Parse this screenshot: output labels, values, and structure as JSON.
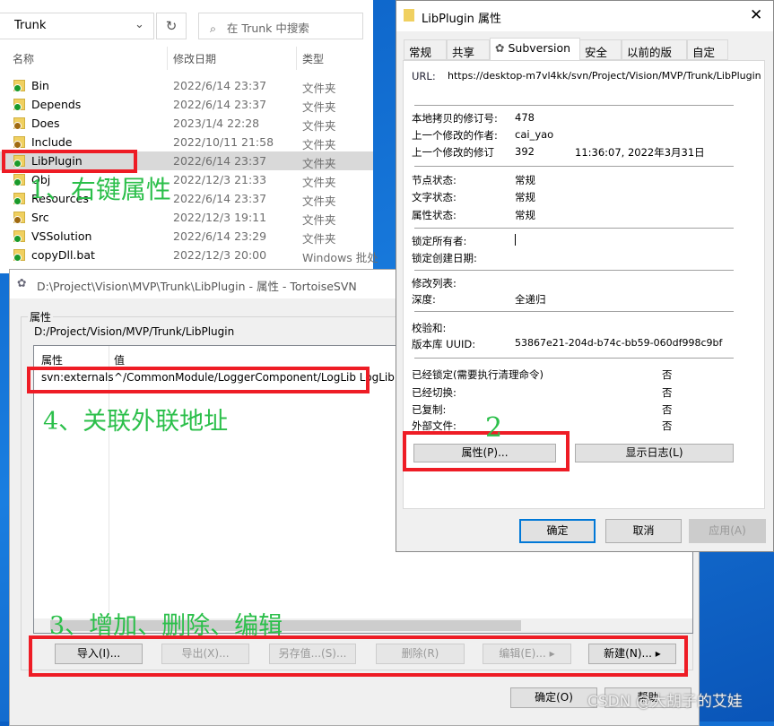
{
  "explorer": {
    "address": "Trunk",
    "search_placeholder": "在 Trunk 中搜索",
    "columns": [
      "名称",
      "修改日期",
      "类型"
    ],
    "rows": [
      {
        "name": "Bin",
        "date": "2022/6/14 23:37",
        "type": "文件夹",
        "status": "ok"
      },
      {
        "name": "Depends",
        "date": "2022/6/14 23:37",
        "type": "文件夹",
        "status": "ok"
      },
      {
        "name": "Does",
        "date": "2023/1/4 22:28",
        "type": "文件夹",
        "status": "modified"
      },
      {
        "name": "Include",
        "date": "2022/10/11 21:58",
        "type": "文件夹",
        "status": "modified"
      },
      {
        "name": "LibPlugin",
        "date": "2022/6/14 23:37",
        "type": "文件夹",
        "status": "ok"
      },
      {
        "name": "Obj",
        "date": "2022/12/3 21:33",
        "type": "文件夹",
        "status": "ok"
      },
      {
        "name": "Resources",
        "date": "2022/6/14 23:37",
        "type": "文件夹",
        "status": "ok"
      },
      {
        "name": "Src",
        "date": "2022/12/3 19:11",
        "type": "文件夹",
        "status": "modified"
      },
      {
        "name": "VSSolution",
        "date": "2022/6/14 23:29",
        "type": "文件夹",
        "status": "ok"
      },
      {
        "name": "copyDll.bat",
        "date": "2022/12/3 20:00",
        "type": "Windows 批处",
        "status": "ok"
      }
    ]
  },
  "annotations": {
    "step1": "1、右键属性",
    "step2": "2",
    "step3": "3、增加、删除、编辑",
    "step4": "4、关联外联地址",
    "watermark": "CSDN @大胡子的艾娃"
  },
  "svn_dialog": {
    "title": "D:\\Project\\Vision\\MVP\\Trunk\\LibPlugin - 属性 - TortoiseSVN",
    "group": "属性",
    "path": "D:/Project/Vision/MVP/Trunk/LibPlugin",
    "headers": [
      "属性",
      "值"
    ],
    "row": {
      "name": "svn:externals",
      "value": "^/CommonModule/LoggerComponent/LogLib LogLib"
    },
    "buttons": {
      "import": "导入(I)...",
      "export": "导出(X)...",
      "save": "另存值...(S)...",
      "delete": "删除(R)",
      "edit": "编辑(E)...",
      "new": "新建(N)...",
      "ok": "确定(O)",
      "help": "帮助"
    }
  },
  "props_dialog": {
    "title": "LibPlugin 属性",
    "tabs": [
      "常规",
      "共享",
      "Subversion",
      "安全",
      "以前的版本",
      "自定义"
    ],
    "url_label": "URL:",
    "url": "https://desktop-m7vl4kk/svn/Project/Vision/MVP/Trunk/LibPlugin",
    "rev_label": "本地拷贝的修订号:",
    "rev": "478",
    "author_label": "上一个修改的作者:",
    "author": "cai_yao",
    "lastrev_label": "上一个修改的修订",
    "lastrev": "392",
    "lastdate": "11:36:07, 2022年3月31日",
    "node_label": "节点状态:",
    "node": "常规",
    "text_label": "文字状态:",
    "text": "常规",
    "prop_label": "属性状态:",
    "prop": "常规",
    "lockowner_label": "锁定所有者:",
    "lockdate_label": "锁定创建日期:",
    "changelist_label": "修改列表:",
    "depth_label": "深度:",
    "depth": "全递归",
    "checksum_label": "校验和:",
    "uuid_label": "版本库 UUID:",
    "uuid": "53867e21-204d-b74c-bb59-060df998c9bf",
    "locked_label": "已经锁定(需要执行清理命令)",
    "locked": "否",
    "switched_label": "已经切换:",
    "switched": "否",
    "copied_label": "已复制:",
    "copied": "否",
    "external_label": "外部文件:",
    "external": "否",
    "properties_btn": "属性(P)...",
    "showlog_btn": "显示日志(L)",
    "ok": "确定",
    "cancel": "取消",
    "apply": "应用(A)"
  },
  "colors": {
    "annotation": "#2bbf4a",
    "highlight": "#ee1c25",
    "desktop": "#0b5fc4"
  }
}
